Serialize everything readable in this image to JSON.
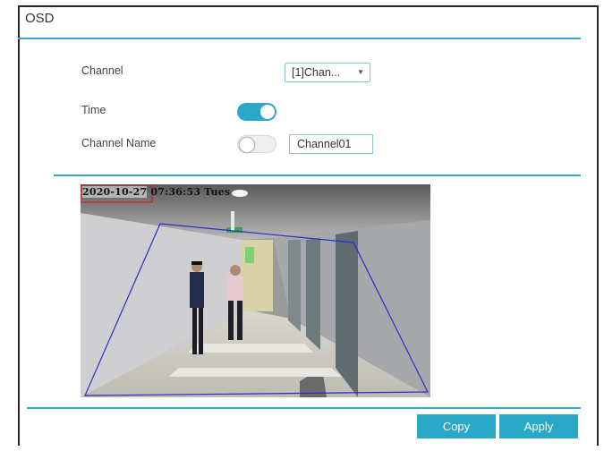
{
  "panel": {
    "title": "OSD"
  },
  "form": {
    "channel_label": "Channel",
    "channel_value": "[1]Chan...",
    "time_label": "Time",
    "time_enabled": true,
    "channel_name_label": "Channel Name",
    "channel_name_enabled": false,
    "channel_name_value": "Channel01"
  },
  "preview": {
    "osd_date": "2020-10-27",
    "osd_time": "07:36:53 Tues"
  },
  "buttons": {
    "copy_label": "Copy",
    "apply_label": "Apply"
  },
  "colors": {
    "accent": "#2aa8c8",
    "region_outline": "#2b2bd0",
    "osd_box": "#e01010"
  },
  "icons": {
    "dropdown": "caret-down-icon"
  }
}
